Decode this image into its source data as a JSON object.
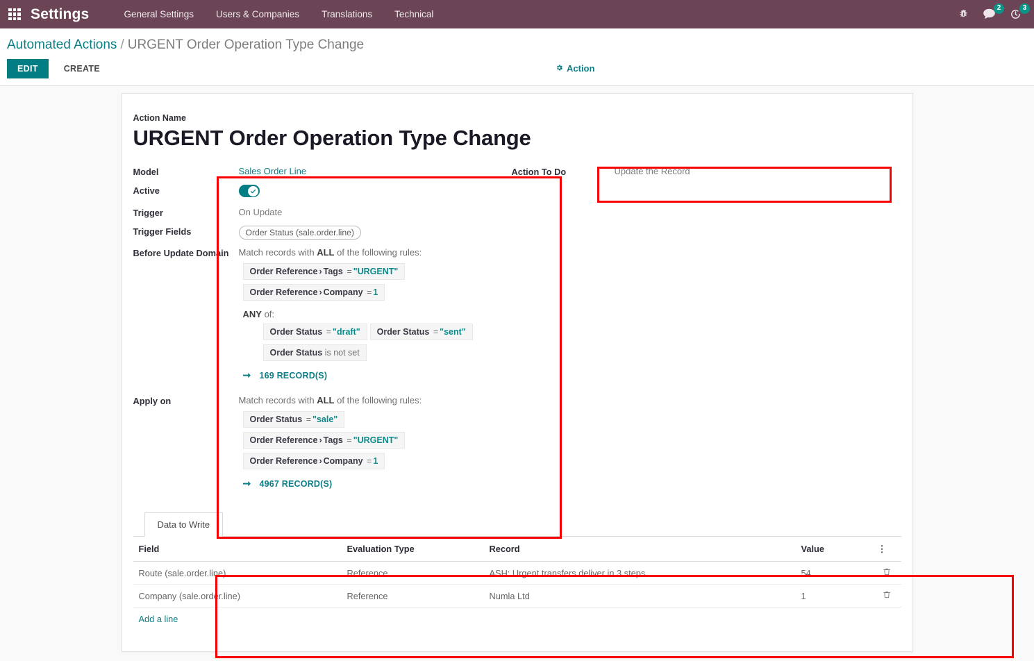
{
  "navbar": {
    "apps_icon": "apps-grid-icon",
    "brand": "Settings",
    "menu": [
      {
        "label": "General Settings"
      },
      {
        "label": "Users & Companies"
      },
      {
        "label": "Translations"
      },
      {
        "label": "Technical"
      }
    ],
    "debug_icon": "bug-icon",
    "messages_icon": "chat-bubble-icon",
    "messages_count": "2",
    "activities_icon": "clock-icon",
    "activities_count": "3"
  },
  "control_panel": {
    "breadcrumb_root": "Automated Actions",
    "breadcrumb_separator": "/",
    "breadcrumb_current": "URGENT Order Operation Type Change",
    "edit_label": "EDIT",
    "create_label": "CREATE",
    "action_label": "Action",
    "action_icon": "gear-icon"
  },
  "form": {
    "action_name_label": "Action Name",
    "action_name_value": "URGENT Order Operation Type Change",
    "fields": {
      "model_label": "Model",
      "model_value": "Sales Order Line",
      "active_label": "Active",
      "active_value": true,
      "trigger_label": "Trigger",
      "trigger_value": "On Update",
      "trigger_fields_label": "Trigger Fields",
      "trigger_fields_value": "Order Status (sale.order.line)",
      "before_update_domain_label": "Before Update Domain",
      "apply_on_label": "Apply on",
      "action_to_do_label": "Action To Do",
      "action_to_do_value": "Update the Record"
    },
    "before_update_domain": {
      "match_prefix": "Match records with",
      "match_all": "ALL",
      "match_suffix": "of the following rules:",
      "rules": [
        {
          "field": "Order Reference",
          "chevron": "›",
          "subfield": "Tags",
          "op": "=",
          "value": "\"URGENT\"",
          "value_styled": true
        },
        {
          "field": "Order Reference",
          "chevron": "›",
          "subfield": "Company",
          "op": "=",
          "value": "1",
          "value_styled": true
        }
      ],
      "any_label": "ANY",
      "any_suffix": "of:",
      "any_rules": [
        {
          "field": "Order Status",
          "op": "=",
          "value": "\"draft\"",
          "value_styled": true
        },
        {
          "field": "Order Status",
          "op": "=",
          "value": "\"sent\"",
          "value_styled": true
        },
        {
          "field": "Order Status",
          "op": "is not set",
          "value": "",
          "value_styled": false
        }
      ],
      "record_count": "169 RECORD(S)"
    },
    "apply_on": {
      "match_prefix": "Match records with",
      "match_all": "ALL",
      "match_suffix": "of the following rules:",
      "rules": [
        {
          "field": "Order Status",
          "op": "=",
          "value": "\"sale\"",
          "value_styled": true
        },
        {
          "field": "Order Reference",
          "chevron": "›",
          "subfield": "Tags",
          "op": "=",
          "value": "\"URGENT\"",
          "value_styled": true
        },
        {
          "field": "Order Reference",
          "chevron": "›",
          "subfield": "Company",
          "op": "=",
          "value": "1",
          "value_styled": true
        }
      ],
      "record_count": "4967 RECORD(S)"
    }
  },
  "notebook": {
    "tabs": [
      {
        "label": "Data to Write",
        "active": true
      }
    ],
    "table": {
      "headers": [
        "Field",
        "Evaluation Type",
        "Record",
        "Value"
      ],
      "options_icon": "vertical-dots-icon",
      "rows": [
        {
          "field": "Route (sale.order.line)",
          "evaluation_type": "Reference",
          "record": "ASH: Urgent transfers deliver in 3 steps",
          "value": "54",
          "delete_icon": "trash-icon"
        },
        {
          "field": "Company (sale.order.line)",
          "evaluation_type": "Reference",
          "record": "Numla Ltd",
          "value": "1",
          "delete_icon": "trash-icon"
        }
      ],
      "add_line_label": "Add a line"
    }
  },
  "annotations": {
    "highlight_color": "#f80000",
    "boxes": [
      {
        "name": "conditions-highlight"
      },
      {
        "name": "action-to-do-highlight"
      },
      {
        "name": "data-to-write-highlight"
      }
    ]
  }
}
